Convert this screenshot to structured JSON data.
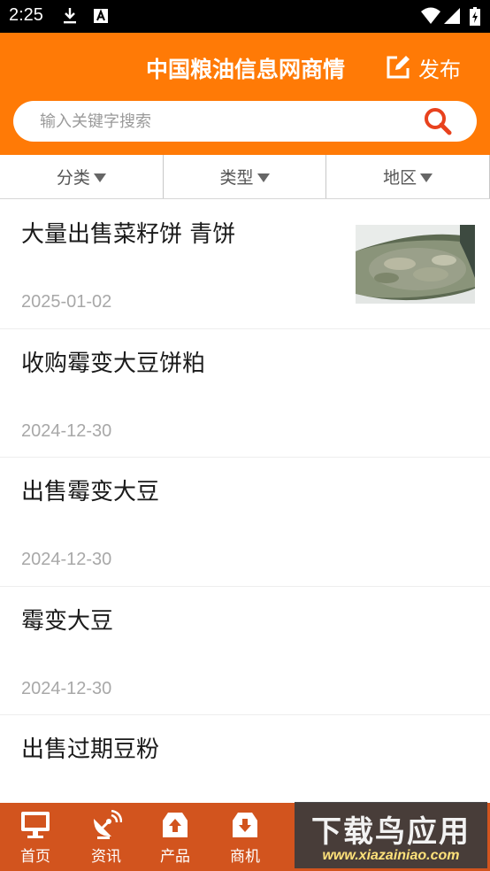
{
  "status_bar": {
    "time": "2:25",
    "icons": [
      "download-icon",
      "a-notification-icon",
      "wifi-icon",
      "signal-icon",
      "battery-icon"
    ]
  },
  "header": {
    "title": "中国粮油信息网商情",
    "publish_label": "发布",
    "background_color": "#ff7a06"
  },
  "search": {
    "placeholder": "输入关键字搜索",
    "value": ""
  },
  "filters": [
    {
      "label": "分类"
    },
    {
      "label": "类型"
    },
    {
      "label": "地区"
    }
  ],
  "items": [
    {
      "title": "大量出售菜籽饼 青饼",
      "date": "2025-01-02",
      "has_image": true
    },
    {
      "title": "收购霉变大豆饼粕",
      "date": "2024-12-30",
      "has_image": false
    },
    {
      "title": "出售霉变大豆",
      "date": "2024-12-30",
      "has_image": false
    },
    {
      "title": "霉变大豆",
      "date": "2024-12-30",
      "has_image": false
    },
    {
      "title": "出售过期豆粉",
      "date": "",
      "has_image": false
    }
  ],
  "tabs": [
    {
      "label": "首页",
      "icon": "monitor-icon"
    },
    {
      "label": "资讯",
      "icon": "satellite-dish-icon"
    },
    {
      "label": "产品",
      "icon": "upload-box-icon"
    },
    {
      "label": "商机",
      "icon": "download-box-icon"
    }
  ],
  "tabbar_color": "#d2541e",
  "watermark": {
    "text": "下载鸟应用",
    "url": "www.xiazainiao.com"
  }
}
